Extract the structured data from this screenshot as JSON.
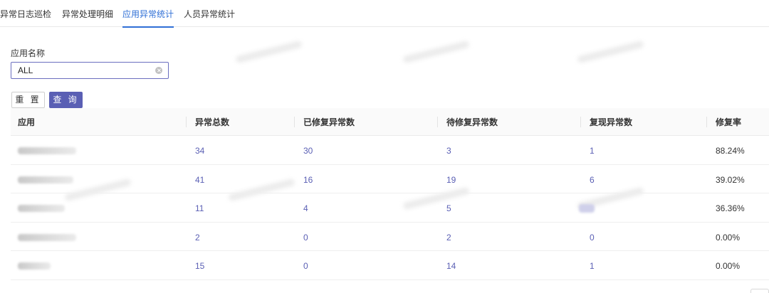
{
  "tabs": [
    {
      "label": "异常日志巡检"
    },
    {
      "label": "异常处理明细"
    },
    {
      "label": "应用异常统计"
    },
    {
      "label": "人员异常统计"
    }
  ],
  "filter": {
    "label": "应用名称",
    "value": "ALL"
  },
  "buttons": {
    "reset": "重 置",
    "query": "查 询"
  },
  "table": {
    "headers": [
      "应用",
      "异常总数",
      "已修复异常数",
      "待修复异常数",
      "复现异常数",
      "修复率"
    ],
    "rows": [
      {
        "total": "34",
        "fixed": "30",
        "pending": "3",
        "reproduced": "1",
        "rate": "88.24%"
      },
      {
        "total": "41",
        "fixed": "16",
        "pending": "19",
        "reproduced": "6",
        "rate": "39.02%"
      },
      {
        "total": "11",
        "fixed": "4",
        "pending": "5",
        "reproduced": "",
        "rate": "36.36%"
      },
      {
        "total": "2",
        "fixed": "0",
        "pending": "2",
        "reproduced": "0",
        "rate": "0.00%"
      },
      {
        "total": "15",
        "fixed": "0",
        "pending": "14",
        "reproduced": "1",
        "rate": "0.00%"
      }
    ]
  },
  "colors": {
    "accent": "#2f6fd6",
    "primary_button": "#5a5fb4",
    "link": "#5a5fb4"
  }
}
